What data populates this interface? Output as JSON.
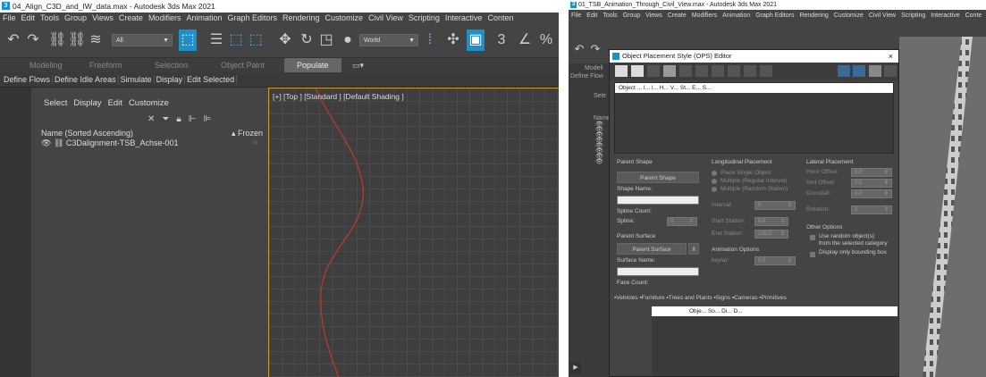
{
  "left": {
    "title": "04_Align_C3D_and_IW_data.max - Autodesk 3ds Max 2021",
    "menu": [
      "File",
      "Edit",
      "Tools",
      "Group",
      "Views",
      "Create",
      "Modifiers",
      "Animation",
      "Graph Editors",
      "Rendering",
      "Customize",
      "Civil View",
      "Scripting",
      "Interactive",
      "Conten"
    ],
    "selection_filter": "All",
    "ref_coord": "World",
    "ribbon_tabs": [
      "Modeling",
      "Freeform",
      "Selection",
      "Object Paint",
      "Populate"
    ],
    "populate_subtabs": [
      "Define Flows",
      "Define Idle Areas",
      "Simulate",
      "Display",
      "Edit Selected"
    ],
    "explorer": {
      "menu": [
        "Select",
        "Display",
        "Edit",
        "Customize"
      ],
      "col_name": "Name (Sorted Ascending)",
      "col_frozen": "▴ Frozen",
      "row": "C3Dalignment-TSB_Achse-001"
    },
    "viewport_label": "[+] [Top ] [Standard ] [Default Shading ]"
  },
  "right": {
    "title": "01_TSB_Animation_Through_Civil_View.max - Autodesk 3ds Max 2021",
    "menu": [
      "File",
      "Edit",
      "Tools",
      "Group",
      "Views",
      "Create",
      "Modifiers",
      "Animation",
      "Graph Editors",
      "Rendering",
      "Customize",
      "Civil View",
      "Scripting",
      "Interactive",
      "Conte"
    ],
    "side_labels": [
      "Modeli",
      "Define Flow",
      "Sele",
      "Name"
    ],
    "dialog": {
      "title": "Object Placement Style (OPS) Editor",
      "close": "×",
      "list_header": "Object ...   I...   I...   H...   V...   St...   E...   S...",
      "parent_shape": "Parent Shape",
      "parent_shape_btn": "Parent Shape",
      "shape_name": "Shape Name:",
      "spline_count": "Spline Count:",
      "spline": "Spline:",
      "spline_val": "0",
      "parent_surface": "Parent Surface",
      "parent_surface_btn": "Parent Surface",
      "x_btn": "X",
      "surface_name": "Surface Name:",
      "face_count": "Face Count:",
      "long_placement": "Longitudinal Placement",
      "place_single": "Place Single Object",
      "multiple_regular": "Multiple (Regular Interval)",
      "multiple_random": "Multiple (Random Station)",
      "interval": "Interval:",
      "interval_val": "0",
      "start_station": "Start Station:",
      "start_val": "0,0",
      "end_station": "End Station:",
      "end_val": "100,0",
      "anim_options": "Animation Options",
      "keyfar": "key/ar:",
      "keyfar_val": "0,0",
      "lat_placement": "Lateral Placement",
      "horiz_offset": "Horiz Offset:",
      "vert_offset": "Vert Offset:",
      "crossfall": "Crossfall:",
      "rotation": "Rotation:",
      "zero": "0,0",
      "rot_val": "0",
      "other_options": "Other Options",
      "use_random": "Use random object(s)",
      "from_category": "from the selected category",
      "display_bbox": "Display only bounding box",
      "categories": "▪Vehicles  ▪Furniture  ▪Trees and Plants  ▪Signs  ▪Cameras  ▪Primitives",
      "list2_header": "Obje...   So...   Di...   D..."
    }
  },
  "colors": {
    "accent": "#c99a2e",
    "curve": "#c0392b",
    "highlight": "#1d8fc9"
  }
}
